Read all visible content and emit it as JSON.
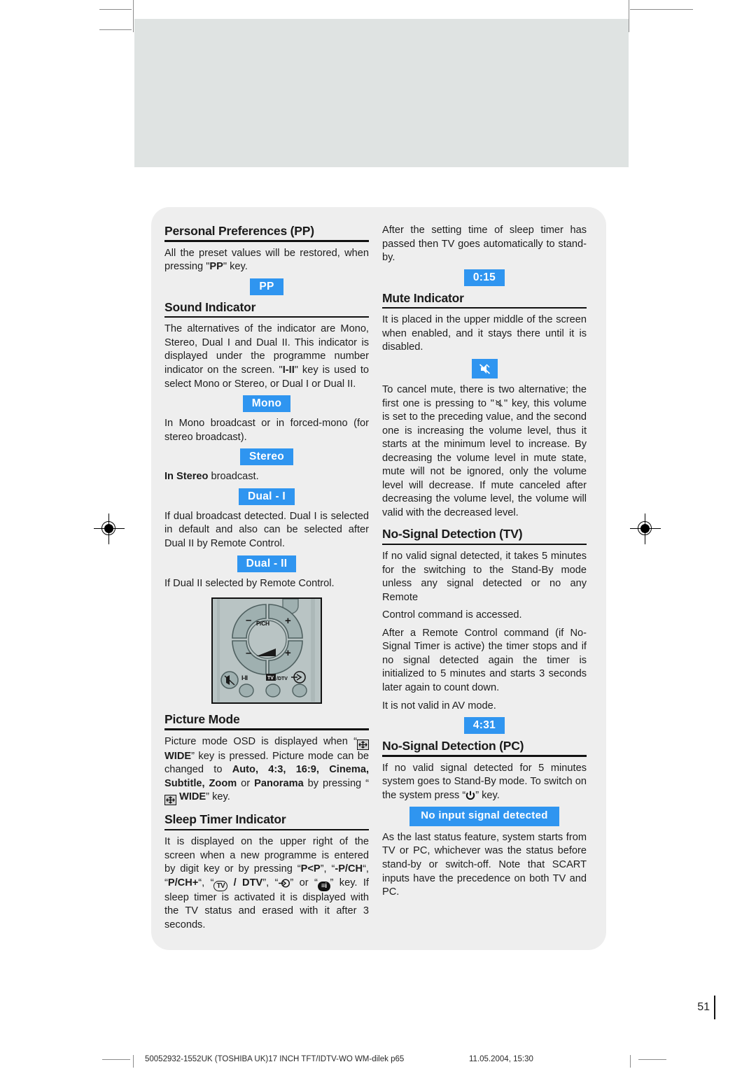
{
  "page": {
    "number": "51",
    "footer_left": "50052932-1552UK (TOSHIBA UK)17 INCH TFT/IDTV-WO WM-dilek p65",
    "footer_right": "11.05.2004, 15:30"
  },
  "left_column": {
    "personal_preferences": {
      "heading": "Personal Preferences (PP)",
      "paragraph_1_a": "All the preset values will be restored, when pressing \"",
      "paragraph_1_key": "PP",
      "paragraph_1_b": "\" key.",
      "badge": "PP"
    },
    "sound_indicator": {
      "heading": "Sound Indicator",
      "paragraph_1_a": "The alternatives of the indicator are Mono, Stereo, Dual I and Dual II. This indicator is displayed under the programme number indicator on the screen. \"",
      "paragraph_1_key": "I-II",
      "paragraph_1_b": "\" key is used to select Mono or Stereo, or Dual I or Dual II.",
      "badge_mono": "Mono",
      "mono_text": "In Mono broadcast or in forced-mono (for stereo broadcast).",
      "badge_stereo": "Stereo",
      "stereo_text_bold": "In Stereo",
      "stereo_text_rest": " broadcast.",
      "badge_dual_1": "Dual - I",
      "dual_1_text": "If dual broadcast detected. Dual I is selected in default and also can be selected after Dual II by Remote Control.",
      "badge_dual_2": "Dual - II",
      "dual_2_text": "If Dual II selected by Remote Control."
    },
    "remote_figure": {
      "label_pch": "P/CH",
      "label_minus": "–",
      "label_plus": "+",
      "button_mute": "mute-icon",
      "button_i_ii": "I-II",
      "button_tv_dtv": "TV / DTV",
      "button_source": "source-icon"
    },
    "picture_mode": {
      "heading": "Picture Mode",
      "text_1": "Picture mode OSD is displayed when “",
      "key_wide": "WIDE",
      "text_2": "” key is pressed. Picture mode can be changed to ",
      "modes": "Auto, 4:3, 16:9, Cinema, Subtitle, Zoom",
      "text_3": " or ",
      "mode_last": "Panorama",
      "text_4": " by pressing “",
      "text_5": "” key."
    },
    "sleep_timer": {
      "heading": "Sleep Timer Indicator",
      "text_1": "It is displayed on the upper right of the screen when a new programme is entered by digit key or by pressing “",
      "key_pbp": "P<P",
      "text_2": "”, “",
      "key_pch_minus": "-P/CH",
      "text_3": "“, “",
      "key_pch_plus": "P/CH+",
      "text_4": "“, “",
      "key_tv": "TV",
      "key_dtv": " / DTV",
      "text_5": "”, “",
      "text_6": "” or “",
      "text_7": "” key. If sleep timer is activated it is displayed with the TV status and erased with it after 3 seconds."
    }
  },
  "right_column": {
    "sleep_timer_cont": {
      "text": "After the setting time of sleep timer has passed then TV goes automatically to stand-by.",
      "badge": "0:15"
    },
    "mute_indicator": {
      "heading": "Mute Indicator",
      "text_1": "It is placed in the upper middle of the screen when enabled, and it stays there until it is disabled.",
      "badge_icon": "mute-icon",
      "text_2_a": "To cancel mute, there is two alternative; the first one is pressing to \"",
      "text_2_b": "\" key, this volume is set to the preceding value, and the second one is increasing the volume level, thus it starts at the minimum level to increase. By decreasing the volume level in mute state, mute will not be ignored, only the volume level will decrease. If mute canceled after decreasing the volume level, the volume will valid with the decreased level."
    },
    "no_signal_tv": {
      "heading": "No-Signal Detection (TV)",
      "text_1": "If no valid signal detected, it takes 5 minutes  for the switching to the Stand-By mode unless any signal detected or no any Remote",
      "text_2": "Control command is accessed.",
      "text_3": "After a Remote Control command (if No-Signal Timer is active) the timer stops and if no signal detected again the timer is initialized to 5 minutes and starts 3 seconds later again to count down.",
      "text_4": "It is not valid in AV mode.",
      "badge": "4:31"
    },
    "no_signal_pc": {
      "heading": "No-Signal Detection (PC)",
      "text_1_a": "If no valid signal detected for 5 minutes system goes to Stand-By mode. To switch on the system press “",
      "text_1_b": "” key.",
      "badge": "No input signal detected",
      "text_2": "As the last status feature, system starts from TV or PC, whichever was the status before stand-by or switch-off. Note that SCART inputs have the precedence on both TV and PC."
    }
  },
  "colors": {
    "badge_blue": "#2f95f0",
    "panel_grey": "#eeeeee",
    "banner_grey": "#dfe3e2",
    "remote_body": "#b9c4c4",
    "remote_key": "#8fa0a0"
  }
}
